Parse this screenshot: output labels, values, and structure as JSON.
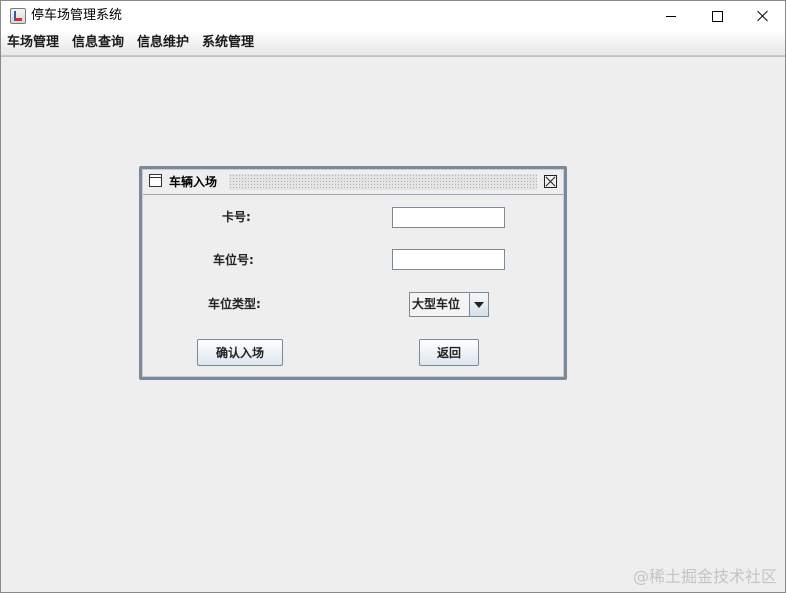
{
  "window": {
    "title": "停车场管理系统",
    "minimize_icon": "minimize-icon",
    "maximize_icon": "maximize-icon",
    "close_icon": "close-icon"
  },
  "menubar": {
    "items": [
      {
        "label": "车场管理"
      },
      {
        "label": "信息查询"
      },
      {
        "label": "信息维护"
      },
      {
        "label": "系统管理"
      }
    ]
  },
  "dialog": {
    "title": "车辆入场",
    "fields": {
      "card_label": "卡号:",
      "card_value": "",
      "space_label": "车位号:",
      "space_value": "",
      "type_label": "车位类型:",
      "type_value": "大型车位"
    },
    "buttons": {
      "confirm": "确认入场",
      "back": "返回"
    }
  },
  "watermark": "@稀土掘金技术社区"
}
